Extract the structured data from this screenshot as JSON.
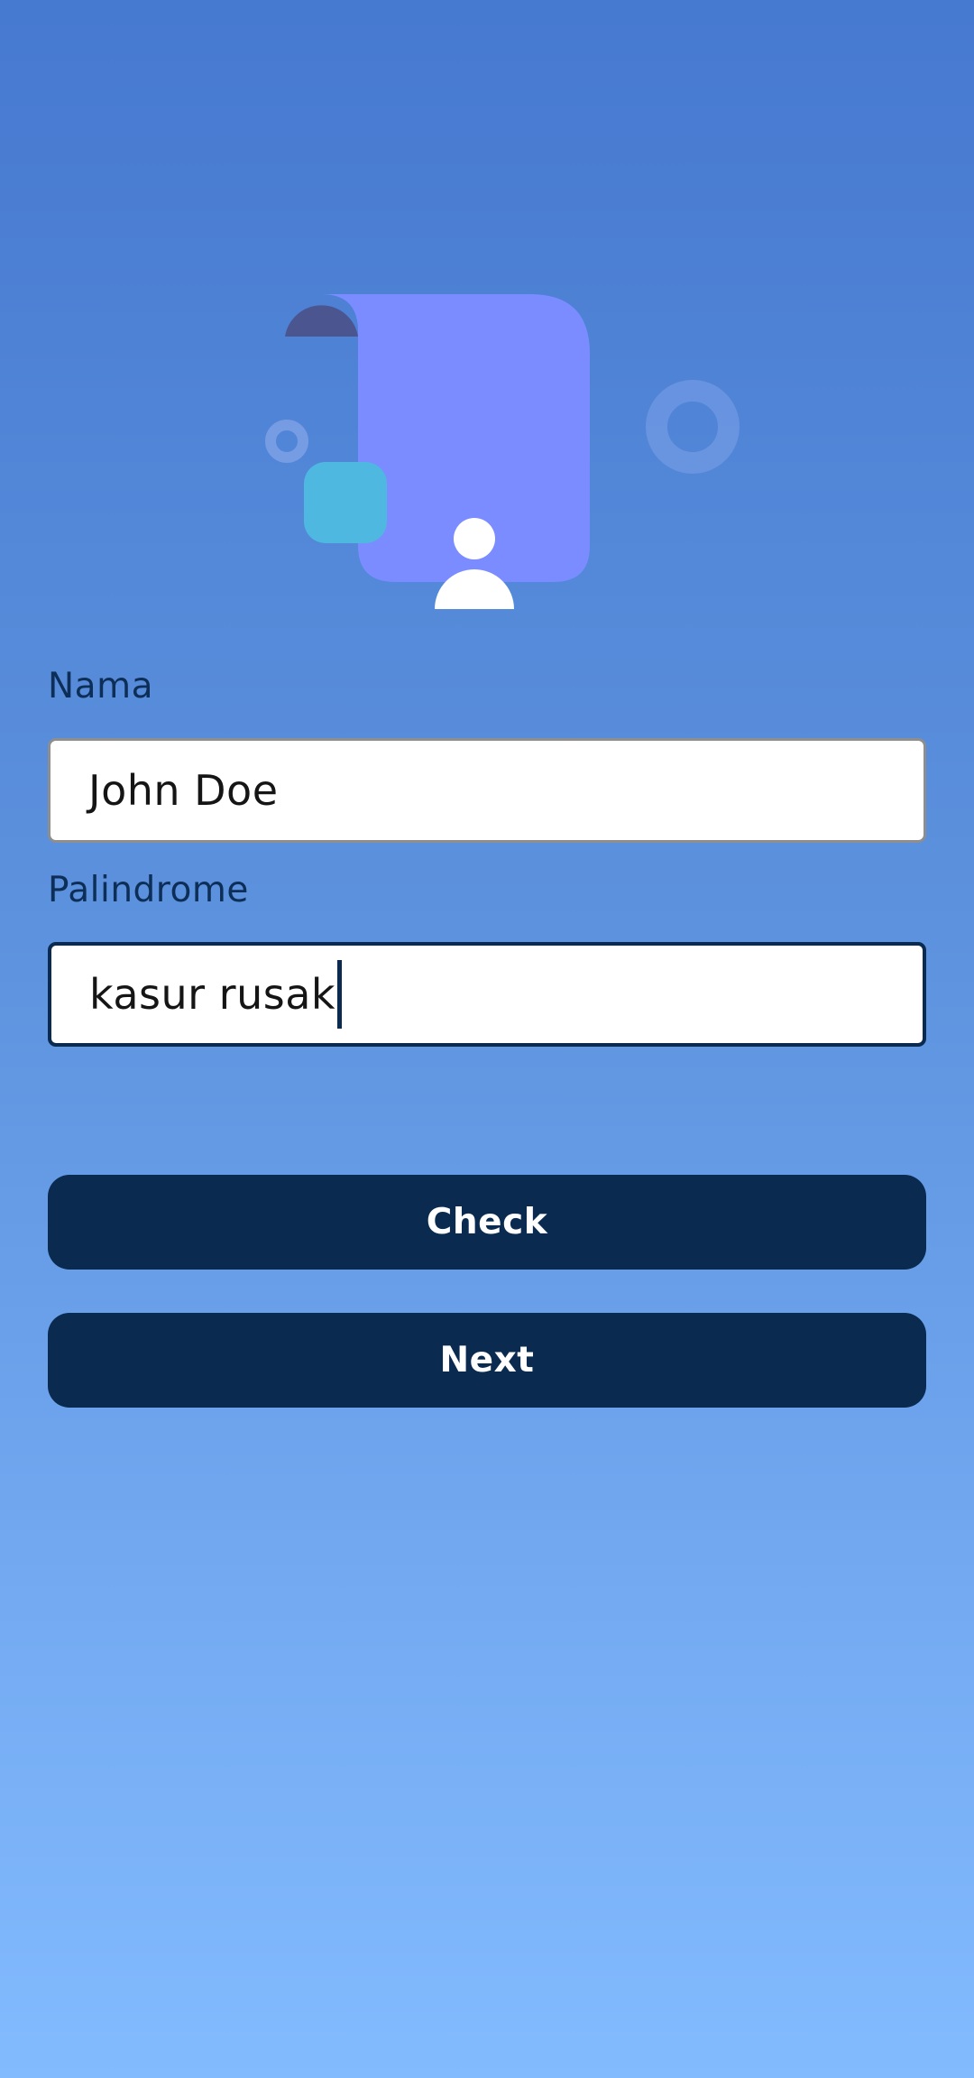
{
  "form": {
    "name_label": "Nama",
    "name_value": "John Doe",
    "palindrome_label": "Palindrome",
    "palindrome_value": "kasur rusak"
  },
  "buttons": {
    "check_label": "Check",
    "next_label": "Next"
  },
  "illustration": {
    "icon": "user-profile-illustration"
  },
  "colors": {
    "background_top": "#4679D0",
    "background_bottom": "#83BBFF",
    "button": "#0A2A4F",
    "label_text": "#0D2E56",
    "illustration_card": "#7A8CFF",
    "illustration_square": "#4FB8E0",
    "illustration_tab": "#4B5590"
  }
}
